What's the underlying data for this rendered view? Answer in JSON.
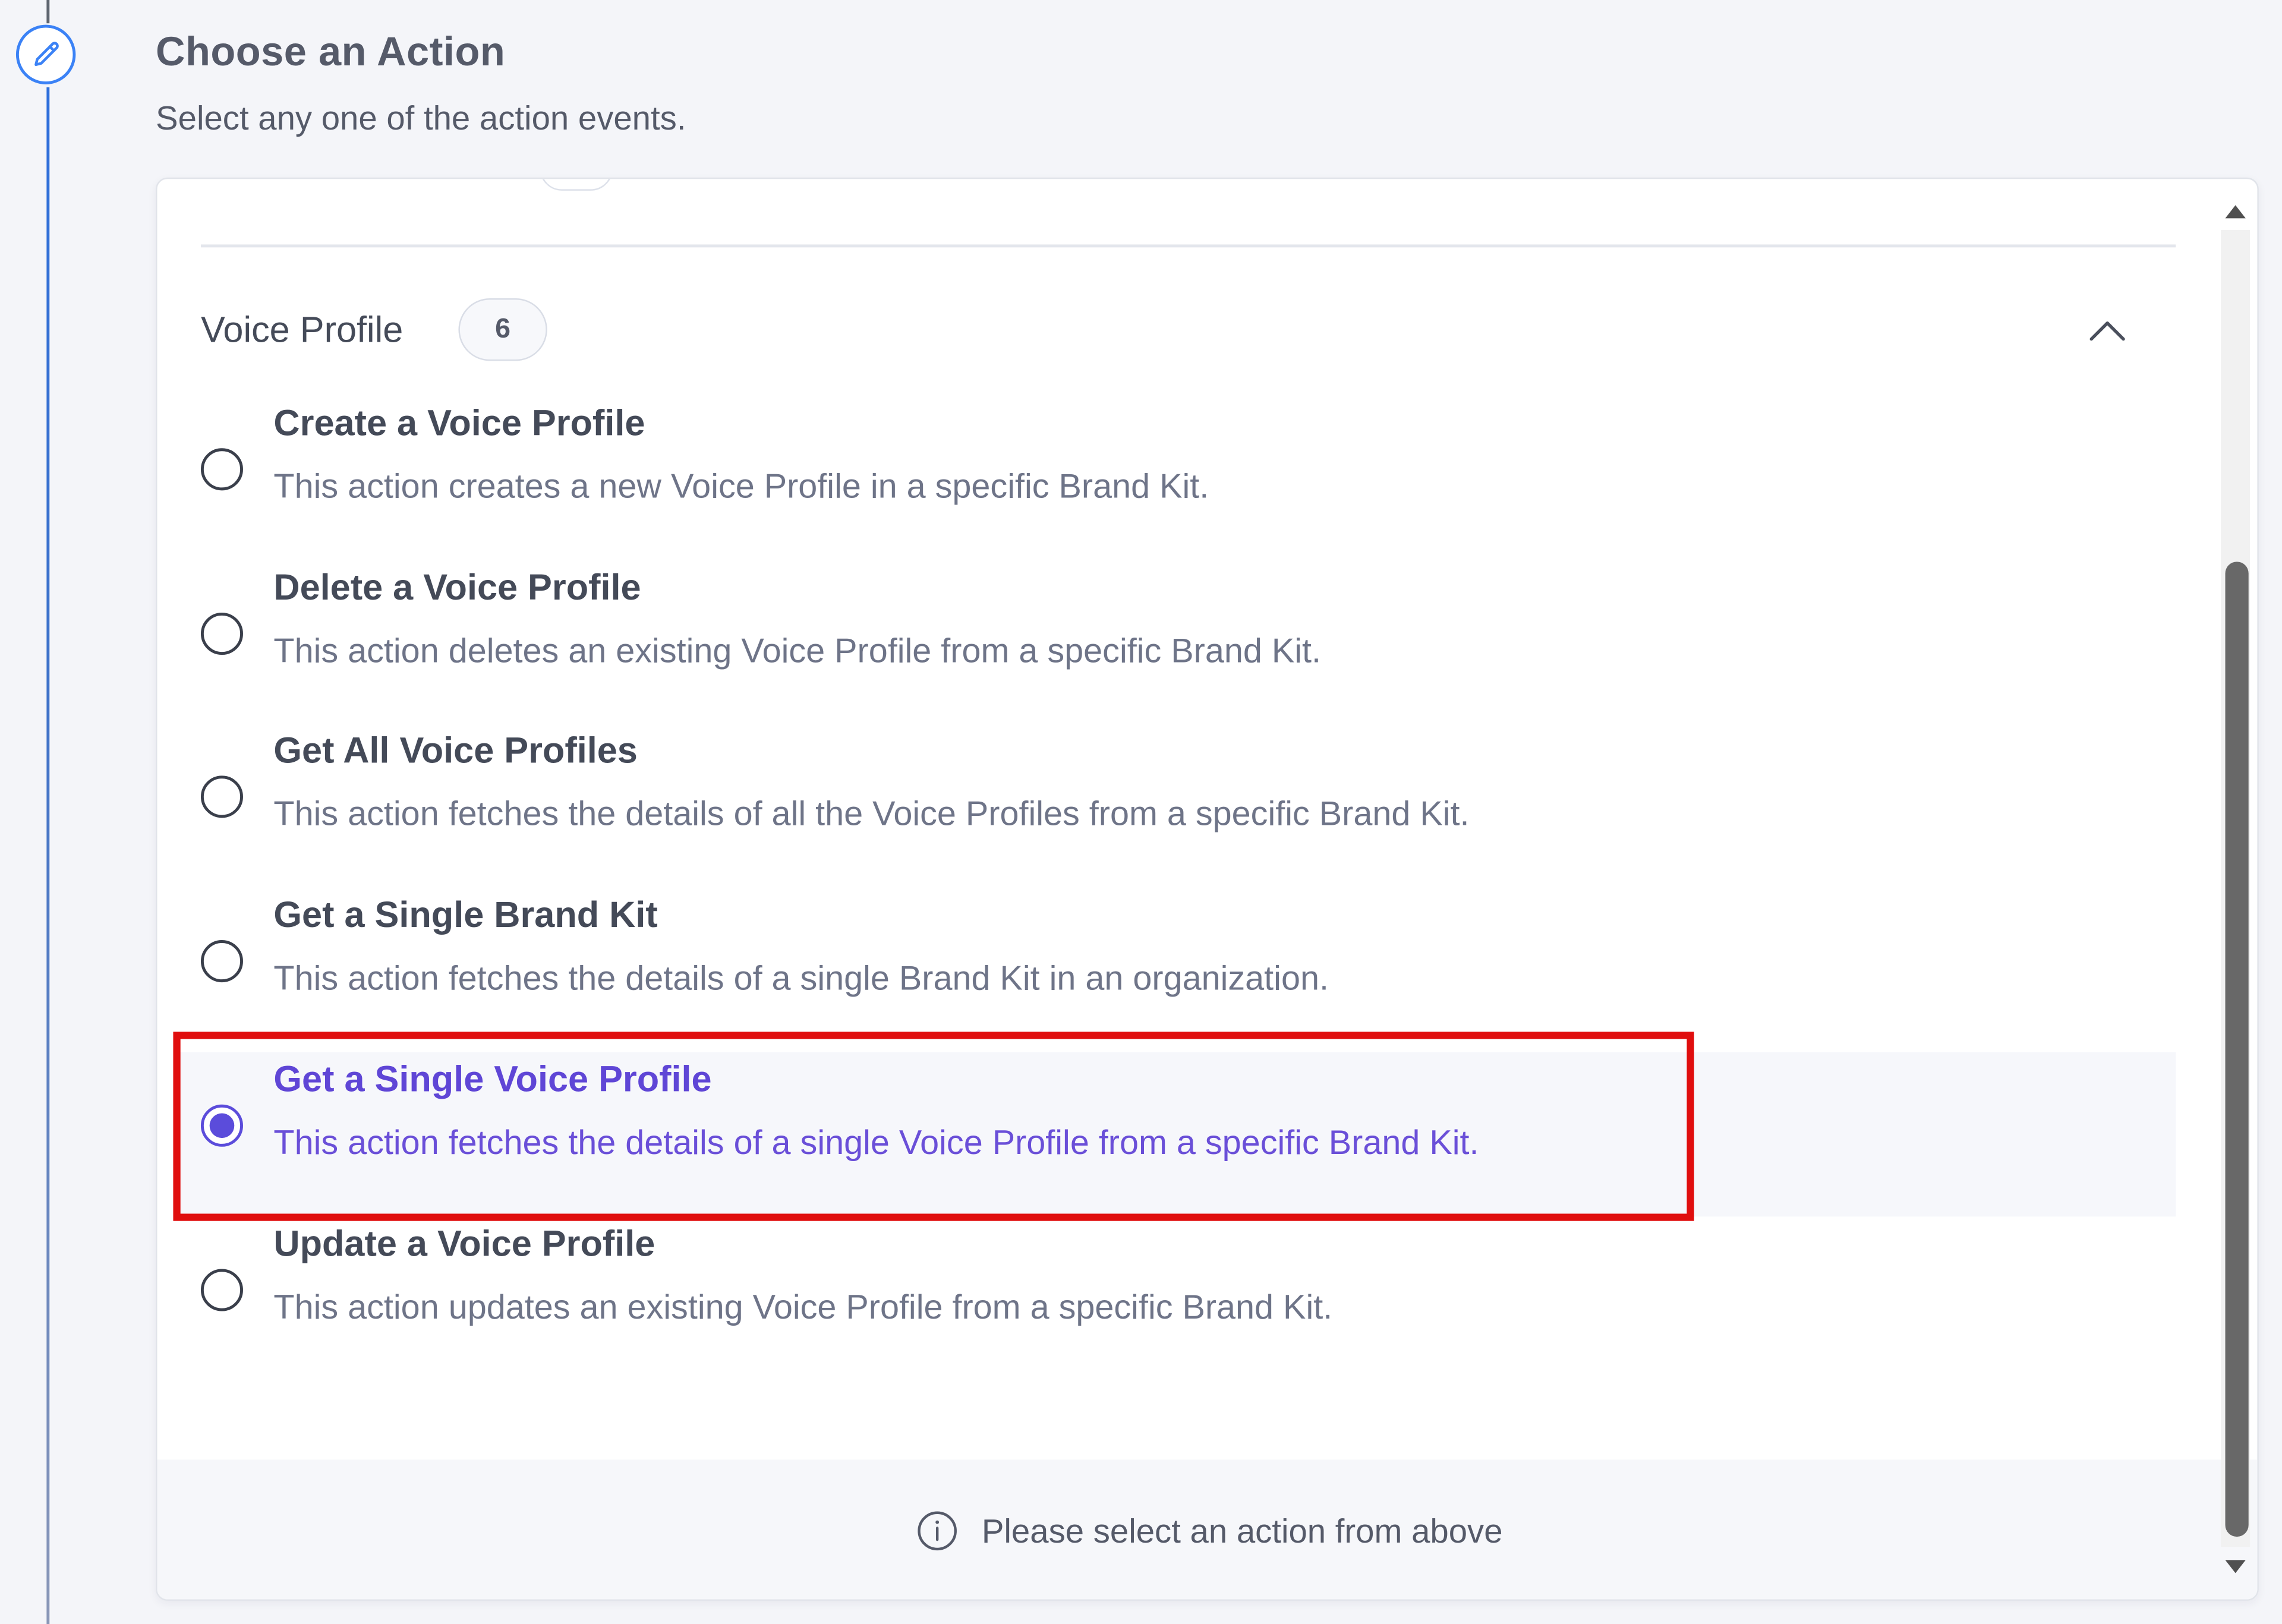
{
  "header": {
    "title": "Choose an Action",
    "subtitle": "Select any one of the action events."
  },
  "group": {
    "title": "Voice Profile",
    "count": "6",
    "expanded": true
  },
  "options": [
    {
      "title": "Create a Voice Profile",
      "description": "This action creates a new Voice Profile in a specific Brand Kit.",
      "selected": false
    },
    {
      "title": "Delete a Voice Profile",
      "description": "This action deletes an existing Voice Profile from a specific Brand Kit.",
      "selected": false
    },
    {
      "title": "Get All Voice Profiles",
      "description": "This action fetches the details of all the Voice Profiles from a specific Brand Kit.",
      "selected": false
    },
    {
      "title": "Get a Single Brand Kit",
      "description": "This action fetches the details of a single Brand Kit in an organization.",
      "selected": false
    },
    {
      "title": "Get a Single Voice Profile",
      "description": "This action fetches the details of a single Voice Profile from a specific Brand Kit.",
      "selected": true
    },
    {
      "title": "Update a Voice Profile",
      "description": "This action updates an existing Voice Profile from a specific Brand Kit.",
      "selected": false
    }
  ],
  "footer": {
    "message": "Please select an action from above"
  },
  "icons": {
    "step": "pencil-icon",
    "collapse": "chevron-up-icon",
    "footer": "info-icon"
  },
  "colors": {
    "accent": "#5b4cdb",
    "highlight": "#e00e0e",
    "timeline": "#3b82f6"
  }
}
